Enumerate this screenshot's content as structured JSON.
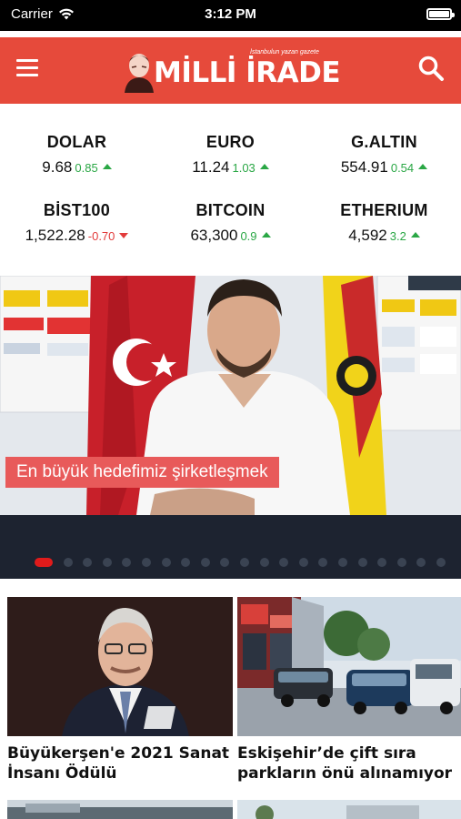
{
  "status": {
    "carrier": "Carrier",
    "time": "3:12 PM"
  },
  "header": {
    "logo_text": "MİLLİ İRADE",
    "logo_tagline": "İstanbulun yazan gazete",
    "logo_prefix": "Eskişehir"
  },
  "markets": [
    {
      "name": "DOLAR",
      "value": "9.68",
      "change": "0.85",
      "direction": "up"
    },
    {
      "name": "EURO",
      "value": "11.24",
      "change": "1.03",
      "direction": "up"
    },
    {
      "name": "G.ALTIN",
      "value": "554.91",
      "change": "0.54",
      "direction": "up"
    },
    {
      "name": "BİST100",
      "value": "1,522.28",
      "change": "-0.70",
      "direction": "down"
    },
    {
      "name": "BITCOIN",
      "value": "63,300",
      "change": "0.9",
      "direction": "up"
    },
    {
      "name": "ETHERIUM",
      "value": "4,592",
      "change": "3.2",
      "direction": "up"
    }
  ],
  "slider": {
    "caption": "En büyük hedefimiz şirketleşmek",
    "dot_count": 21,
    "active_index": 0
  },
  "news": [
    {
      "title": "Büyükerşen'e 2021 Sanat İnsanı Ödülü"
    },
    {
      "title": "Eskişehir’de çift sıra parkların önü alınamıyor"
    }
  ],
  "colors": {
    "brand_red": "#e64a3b",
    "up": "#2aa745",
    "down": "#e23b3b",
    "slider_bar": "#1d2330",
    "dot_active": "#e01b1b"
  }
}
